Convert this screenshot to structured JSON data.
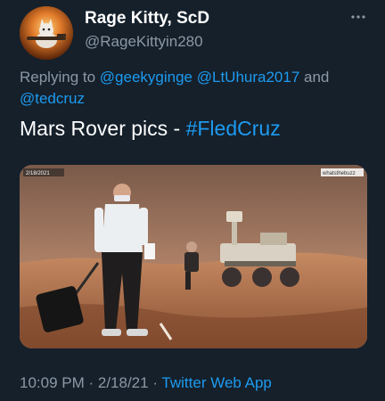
{
  "author": {
    "display_name": "Rage Kitty, ScD",
    "handle": "@RageKittyin280"
  },
  "reply": {
    "prefix": "Replying to ",
    "mentions": [
      "@geekyginge",
      "@LtUhura2017",
      "@tedcruz"
    ],
    "conjunction": " and "
  },
  "tweet": {
    "text": "Mars Rover pics - ",
    "hashtag": "#FledCruz"
  },
  "media": {
    "watermark_left": "2/18/2021",
    "watermark_right": "whatsthebuzz"
  },
  "meta": {
    "time": "10:09 PM",
    "separator": " · ",
    "date": "2/18/21",
    "source": "Twitter Web App"
  },
  "colors": {
    "background": "#15202b",
    "accent": "#1d9bf0",
    "secondary_text": "#8b98a5"
  },
  "icons": {
    "more": "more-horizontal-icon"
  }
}
